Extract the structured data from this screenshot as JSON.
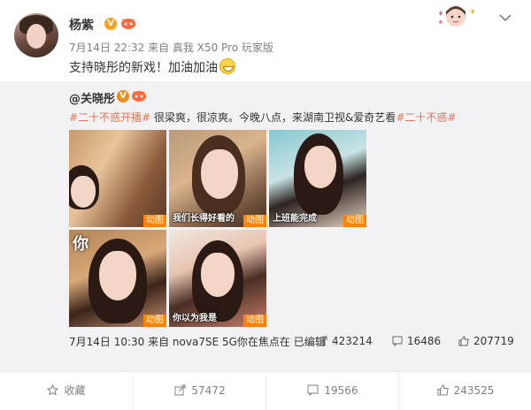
{
  "post": {
    "username": "杨紫",
    "verified_badge": "V",
    "meta": "7月14日 22:32 来自 真我 X50 Pro 玩家版",
    "text": "支持晓彤的新戏！加油加油"
  },
  "repost": {
    "username": "@关晓彤",
    "verified_badge": "V",
    "text_parts": [
      {
        "text": "#二十不惑开播#",
        "tag": true
      },
      {
        "text": " 很梁爽，很凉爽。今晚八点，来湖南卫视&爱奇艺看",
        "tag": false
      },
      {
        "text": "#二十不惑#",
        "tag": true
      }
    ],
    "media": [
      {
        "caption": "",
        "overlay_char": "",
        "badge": "动图"
      },
      {
        "caption": "我们长得好看的",
        "overlay_char": "",
        "badge": "动图"
      },
      {
        "caption": "上班能完成",
        "overlay_char": "",
        "badge": "动图"
      },
      {
        "caption": "",
        "overlay_char": "你",
        "badge": "动图"
      },
      {
        "caption": "你以为我是",
        "overlay_char": "",
        "badge": "动图"
      }
    ],
    "footer_meta": "7月14日 10:30 来自 nova7SE 5G你在焦点在 已编辑",
    "stats": {
      "forwards": "423214",
      "comments": "16486",
      "likes": "207719"
    }
  },
  "actions": {
    "favorite": "收藏",
    "forward": "57472",
    "comment": "19566",
    "like": "243525"
  },
  "colors": {
    "tag": "#eb7350",
    "gif_badge": "#ff8200",
    "repost_bg": "#f2f2f5"
  }
}
